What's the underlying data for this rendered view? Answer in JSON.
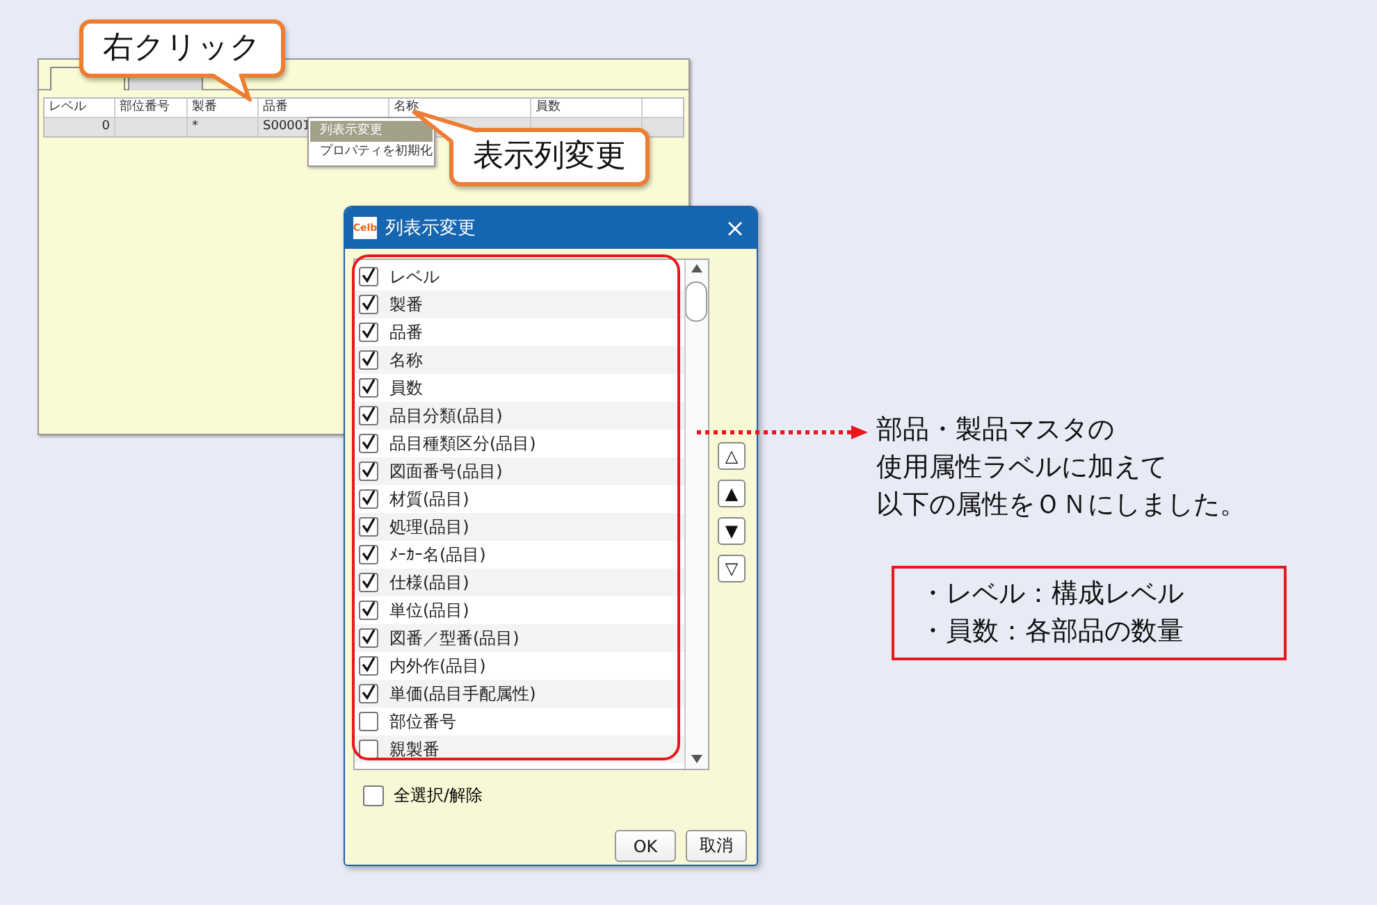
{
  "background_window": {
    "tabs": [
      {
        "selected": true
      },
      {
        "selected": false
      }
    ],
    "columns": [
      "レベル",
      "部位番号",
      "製番",
      "品番",
      "名称",
      "員数"
    ],
    "row": {
      "column_1": "0",
      "column_3": "*",
      "column_4": "S00001"
    }
  },
  "context_menu": {
    "items": [
      {
        "label": "列表示変更",
        "selected": true
      },
      {
        "label": "プロパティを初期化",
        "selected": false
      }
    ]
  },
  "callouts": [
    {
      "text": "右クリック",
      "kind": "down"
    },
    {
      "text": "表示列変更",
      "kind": "up"
    }
  ],
  "dialog": {
    "title": "列表示変更",
    "icon_label": "Celb",
    "items": [
      {
        "label": "レベル",
        "checked": true
      },
      {
        "label": "製番",
        "checked": true
      },
      {
        "label": "品番",
        "checked": true
      },
      {
        "label": "名称",
        "checked": true
      },
      {
        "label": "員数",
        "checked": true
      },
      {
        "label": "品目分類(品目)",
        "checked": true
      },
      {
        "label": "品目種類区分(品目)",
        "checked": true
      },
      {
        "label": "図面番号(品目)",
        "checked": true
      },
      {
        "label": "材質(品目)",
        "checked": true
      },
      {
        "label": "処理(品目)",
        "checked": true
      },
      {
        "label": "ﾒｰｶｰ名(品目)",
        "checked": true
      },
      {
        "label": "仕様(品目)",
        "checked": true
      },
      {
        "label": "単位(品目)",
        "checked": true
      },
      {
        "label": "図番／型番(品目)",
        "checked": true
      },
      {
        "label": "内外作(品目)",
        "checked": true
      },
      {
        "label": "単価(品目手配属性)",
        "checked": true
      },
      {
        "label": "部位番号",
        "checked": false
      },
      {
        "label": "親製番",
        "checked": false
      }
    ],
    "order_buttons": [
      "△",
      "▲",
      "▼",
      "▽"
    ],
    "select_all": {
      "label": "全選択/解除",
      "checked": false
    },
    "buttons": [
      "OK",
      "取消"
    ]
  },
  "note": {
    "lines": [
      "部品・製品マスタの",
      "使用属性ラベルに加えて",
      "以下の属性をＯＮにしました。"
    ],
    "box_lines": [
      "・レベル：構成レベル",
      "・員数：各部品の数量"
    ]
  }
}
